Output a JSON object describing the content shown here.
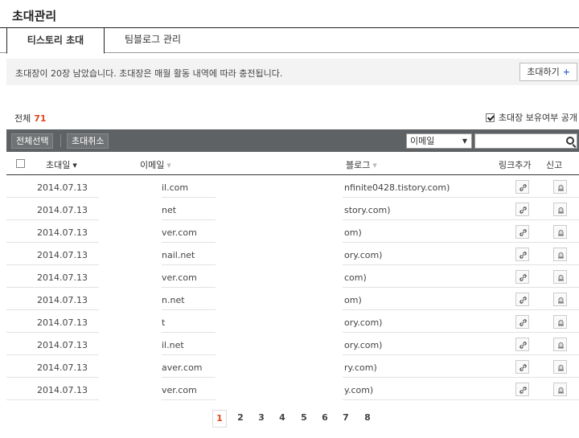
{
  "page": {
    "title": "초대관리"
  },
  "tabs": [
    {
      "label": "티스토리 초대",
      "active": true
    },
    {
      "label": "팀블로그 관리",
      "active": false
    }
  ],
  "info": {
    "message": "초대장이 20장 남았습니다. 초대장은 매월 활동 내역에 따라 충전됩니다.",
    "invite_button": "초대하기",
    "invite_plus": "+"
  },
  "summary": {
    "total_label": "전체",
    "total_count": "71",
    "public_label": "초대장 보유여부 공개",
    "public_checked": true
  },
  "toolbar": {
    "select_all": "전체선택",
    "cancel_invite": "초대취소",
    "filter_selected": "이메일",
    "search_value": ""
  },
  "table": {
    "headers": {
      "date": "초대일",
      "email": "이메일",
      "blog": "블로그",
      "link": "링크추가",
      "report": "신고"
    },
    "rows": [
      {
        "date": "2014.07.13",
        "email": "il.com",
        "blog": "nfinite0428.tistory.com)"
      },
      {
        "date": "2014.07.13",
        "email": "net",
        "blog": "story.com)"
      },
      {
        "date": "2014.07.13",
        "email": "ver.com",
        "blog": "om)"
      },
      {
        "date": "2014.07.13",
        "email": "nail.net",
        "blog": "ory.com)"
      },
      {
        "date": "2014.07.13",
        "email": "ver.com",
        "blog": "com)"
      },
      {
        "date": "2014.07.13",
        "email": "n.net",
        "blog": "om)"
      },
      {
        "date": "2014.07.13",
        "email": "t",
        "blog": "ory.com)"
      },
      {
        "date": "2014.07.13",
        "email": "il.net",
        "blog": "ory.com)"
      },
      {
        "date": "2014.07.13",
        "email": "aver.com",
        "blog": "ry.com)"
      },
      {
        "date": "2014.07.13",
        "email": "ver.com",
        "blog": "y.com)"
      }
    ]
  },
  "pagination": {
    "pages": [
      "1",
      "2",
      "3",
      "4",
      "5",
      "6",
      "7",
      "8"
    ],
    "current": "1"
  },
  "colors": {
    "accent": "#e0461f",
    "toolbar_bg": "#5f6264",
    "info_bg": "#f3f3f3",
    "plus": "#3a6ec9"
  }
}
